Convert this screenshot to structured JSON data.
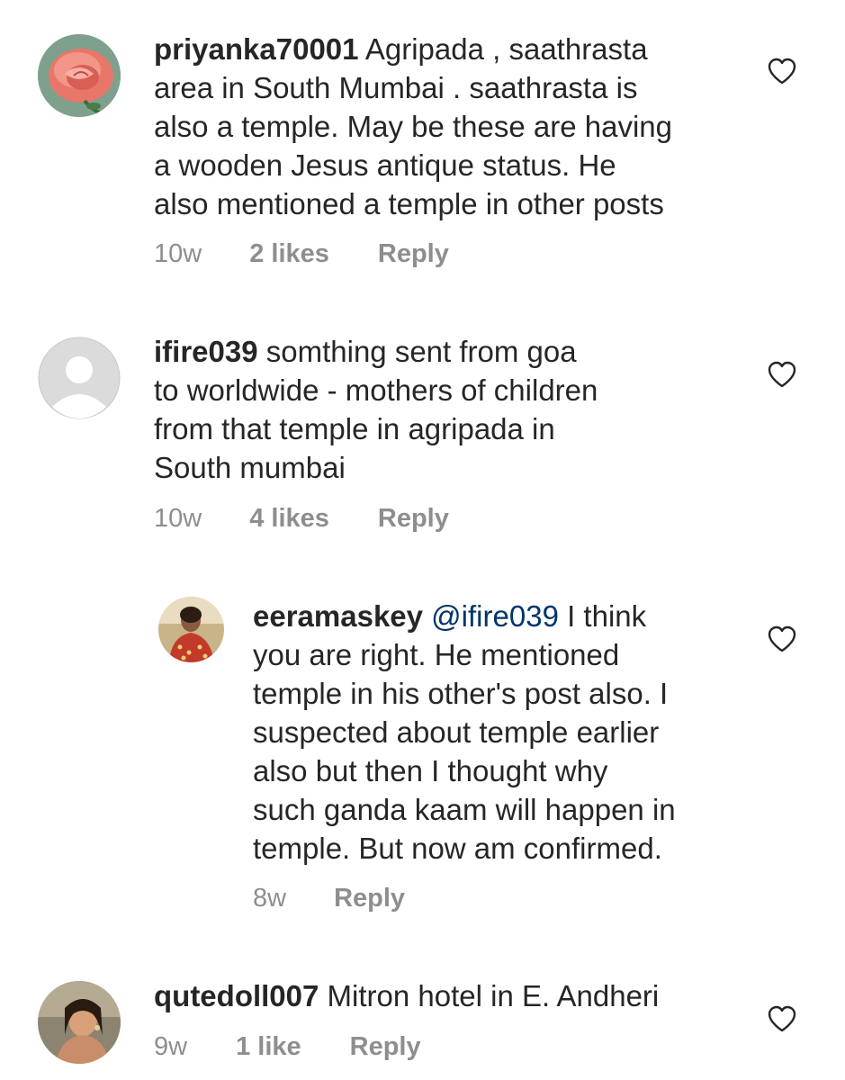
{
  "comments": [
    {
      "username": "priyanka70001",
      "lines": [
        " Agripada , saathrasta",
        "area in South Mumbai . saathrasta is",
        "also a temple. May be these are having",
        "a wooden Jesus antique status. He",
        "also mentioned a temple in other posts"
      ],
      "time": "10w",
      "likes": "2 likes",
      "reply": "Reply"
    },
    {
      "username": "ifire039",
      "lines": [
        " somthing sent from goa",
        "to worldwide - mothers of children",
        "from that temple in agripada in",
        "South mumbai"
      ],
      "time": "10w",
      "likes": "4 likes",
      "reply": "Reply"
    },
    {
      "username": "eeramaskey",
      "mention": " @ifire039",
      "lines": [
        " I think",
        "you are right. He mentioned",
        "temple in his other's post also.  I",
        "suspected about temple earlier",
        "also but then I thought why",
        "such ganda kaam will happen in",
        "temple. But now am confirmed."
      ],
      "time": "8w",
      "reply": "Reply"
    },
    {
      "username": "qutedoll007",
      "lines": [
        " Mitron hotel in E. Andheri"
      ],
      "time": "9w",
      "likes": "1 like",
      "reply": "Reply"
    }
  ],
  "icons": {
    "like": "heart-outline-icon",
    "default_avatar": "default-avatar-icon"
  },
  "colors": {
    "text": "#262626",
    "meta": "#8e8e8e",
    "mention": "#003569"
  }
}
